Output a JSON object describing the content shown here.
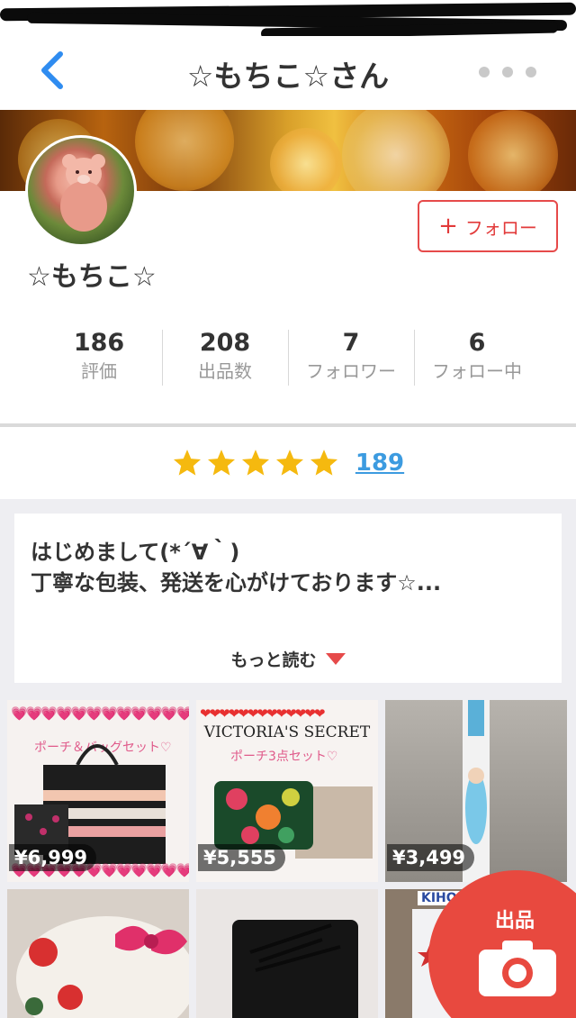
{
  "nav": {
    "title": "☆もちこ☆さん"
  },
  "profile": {
    "username": "☆もちこ☆",
    "follow_label": "フォロー",
    "stats": [
      {
        "value": "186",
        "label": "評価"
      },
      {
        "value": "208",
        "label": "出品数"
      },
      {
        "value": "7",
        "label": "フォロワー"
      },
      {
        "value": "6",
        "label": "フォロー中"
      }
    ]
  },
  "rating": {
    "stars": 5,
    "count": "189"
  },
  "intro": {
    "line1": "はじめまして(*´∀｀)",
    "line2": "丁寧な包装、発送を心がけております☆...",
    "read_more": "もっと読む"
  },
  "items": [
    {
      "price": "¥6,999",
      "caption": "ポーチ＆バッグセット♡"
    },
    {
      "price": "¥5,555",
      "heading": "VICTORIA'S SECRET",
      "caption": "ポーチ3点セット♡"
    },
    {
      "price": "¥3,499"
    },
    {},
    {},
    {
      "heading": "KIHOU"
    }
  ],
  "fab": {
    "label": "出品"
  },
  "colors": {
    "accent": "#e64a4a",
    "link": "#3c9be0",
    "star": "#f5b90f",
    "back": "#2f8cf0"
  }
}
